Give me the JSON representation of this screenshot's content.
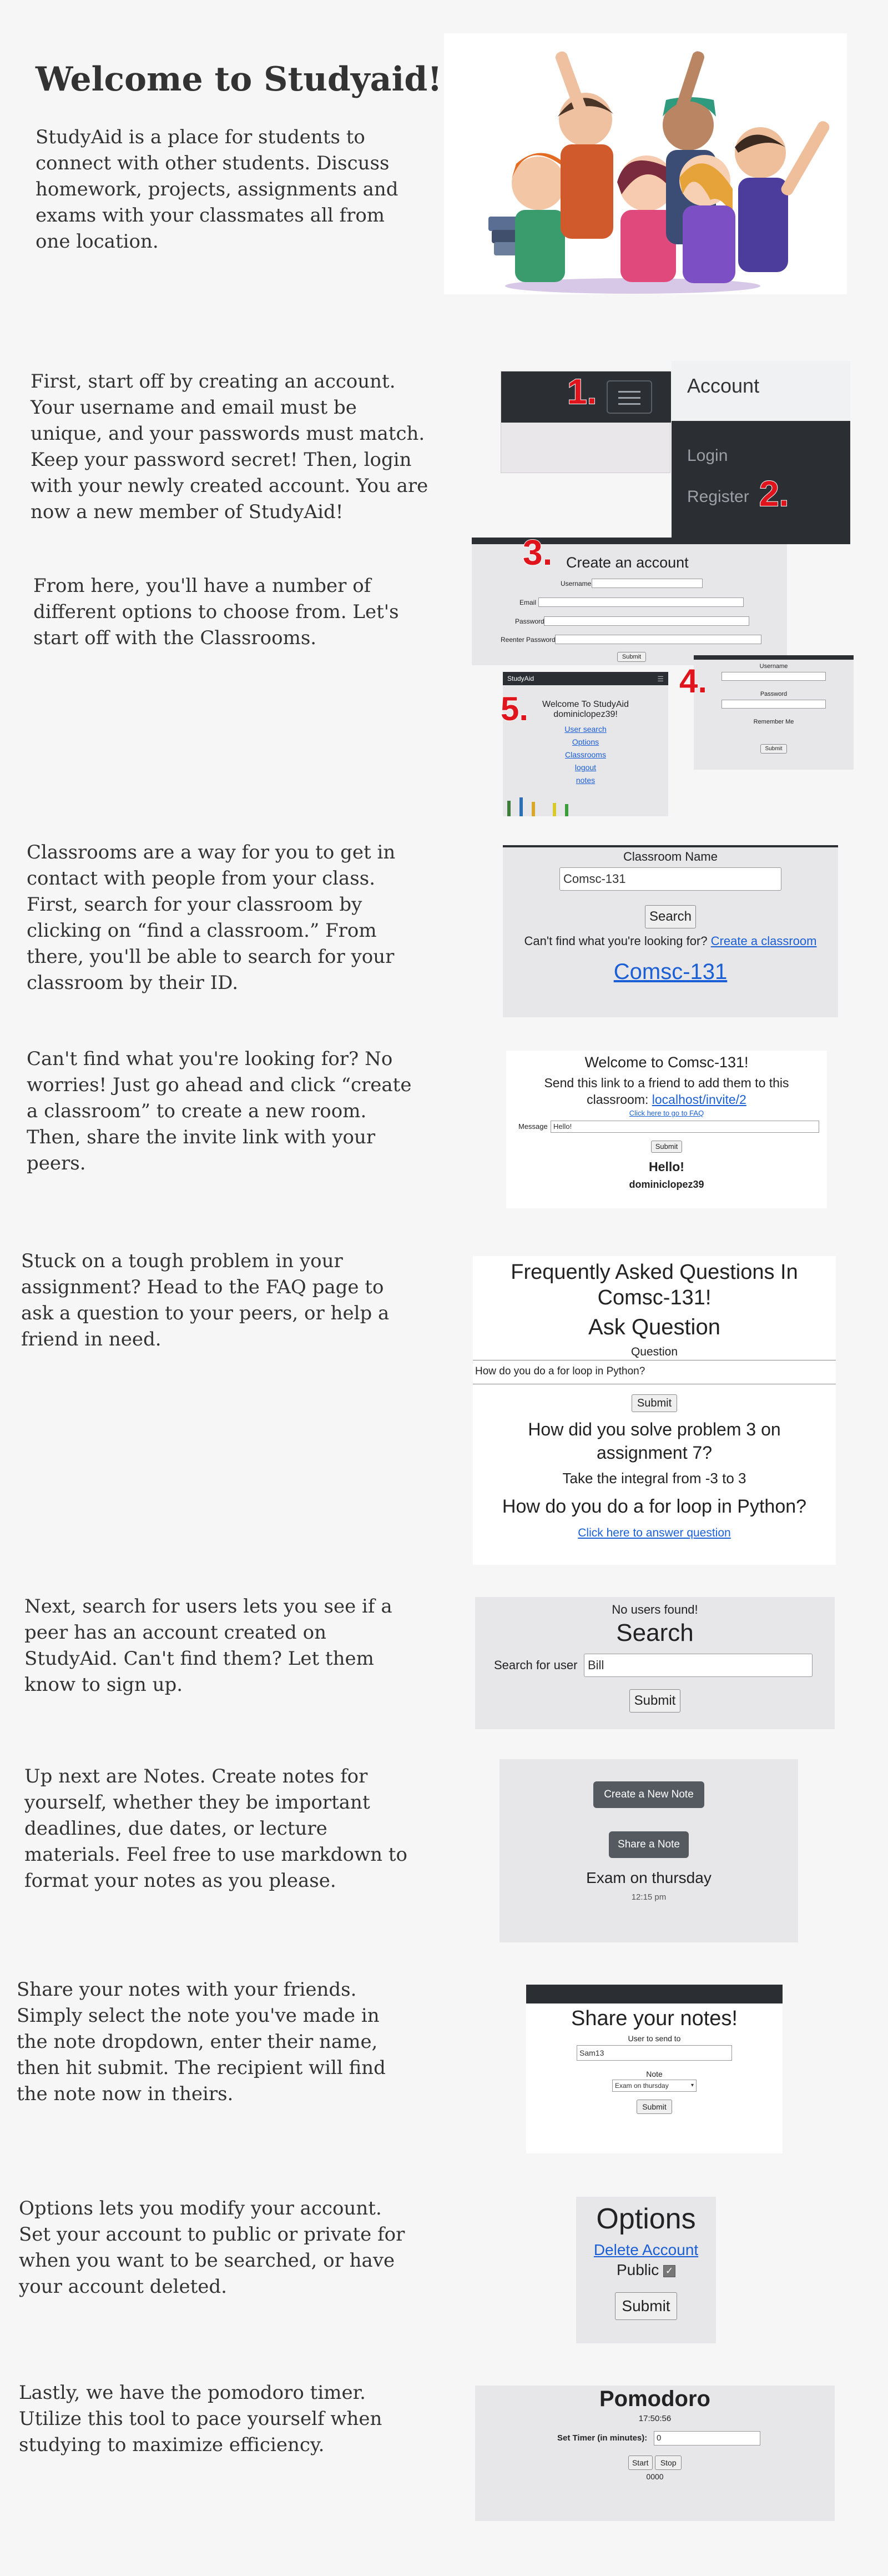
{
  "hero": {
    "title": "Welcome to Studyaid!",
    "text": "StudyAid is a place for students to connect with other students. Discuss homework, projects, assignments and exams with your classmates all from one location."
  },
  "sections": {
    "account": "First, start off by creating an account. Your username and email must be unique, and your passwords must match.\nKeep your password secret! Then, login with your newly created account. You are now a new member of StudyAid!",
    "options_intro": "From here, you'll have a number of different options to choose from. Let's start off with the Classrooms.",
    "classrooms": "Classrooms are a way for you to get in contact with people from your class. First, search for your classroom by clicking on “find a classroom.” From there, you'll be able to search for your classroom by their ID.",
    "create_classroom": "Can't find what you're looking for? No worries! Just go ahead and click “create a classroom” to create a new room. Then, share the invite link with your peers.",
    "faq": "Stuck on a tough problem in your assignment? Head to the FAQ page to ask a question to your peers, or help a friend in need.",
    "users": "Next, search for users lets you see if a peer has an account created on StudyAid. Can't find them? Let them know to sign up.",
    "notes": "Up next are Notes. Create notes for yourself, whether they be important deadlines, due dates, or lecture materials. Feel free to use markdown to format your notes as you please.",
    "share": "Share your notes with your friends. Simply select the note you've made in the note dropdown, enter their name, then hit submit. The recipient will find the note now in theirs.",
    "options": "Options lets you modify your account. Set your account to public or private for when you want to be searched, or have your account deleted.",
    "pomodoro": "Lastly, we have the pomodoro timer. Utilize this tool to pace yourself when studying to maximize efficiency."
  },
  "nav_shot": {
    "marker1": "1.",
    "marker2": "2.",
    "account_label": "Account",
    "login": "Login",
    "register": "Register"
  },
  "register_shot": {
    "marker": "3.",
    "title": "Create an account",
    "username": "Username",
    "email": "Email",
    "password": "Password",
    "reenter": "Reenter Password",
    "submit": "Submit"
  },
  "login_shot": {
    "marker": "4.",
    "username": "Username",
    "password": "Password",
    "remember": "Remember Me",
    "submit": "Submit"
  },
  "home_shot": {
    "marker": "5.",
    "brand": "StudyAid",
    "welcome": "Welcome To StudyAid",
    "user": "dominiclopez39!",
    "links": [
      "User search",
      "Options",
      "Classrooms",
      "logout",
      "notes"
    ]
  },
  "classroom_shot": {
    "label": "Classroom Name",
    "value": "Comsc-131",
    "search": "Search",
    "cant_find": "Can't find what you're looking for?",
    "create_link": "Create a classroom",
    "result": "Comsc-131"
  },
  "room_shot": {
    "title": "Welcome to Comsc-131!",
    "share_text": "Send this link to a friend to add them to this classroom:",
    "invite": "localhost/invite/2",
    "faq_link": "Click here to go to FAQ",
    "message_label": "Message",
    "message_value": "Hello!",
    "submit": "Submit",
    "msg": "Hello!",
    "author": "dominiclopez39"
  },
  "faq_shot": {
    "title": "Frequently Asked Questions In Comsc-131!",
    "ask": "Ask Question",
    "q_label": "Question",
    "q_value": "How do you do a for loop in Python?",
    "submit": "Submit",
    "q1": "How did you solve problem 3 on assignment 7?",
    "a1": "Take the integral from -3 to 3",
    "q2": "How do you do a for loop in Python?",
    "answer_link": "Click here to answer question"
  },
  "users_shot": {
    "none": "No users found!",
    "title": "Search",
    "label": "Search for user",
    "value": "Bill",
    "submit": "Submit"
  },
  "notes_shot": {
    "create": "Create a New Note",
    "share": "Share a Note",
    "note_title": "Exam on thursday",
    "time": "12:15 pm"
  },
  "share_shot": {
    "title": "Share your notes!",
    "user_label": "User to send to",
    "user_value": "Sam13",
    "note_label": "Note",
    "note_value": "Exam on thursday",
    "submit": "Submit"
  },
  "options_shot": {
    "title": "Options",
    "delete": "Delete Account",
    "public": "Public",
    "submit": "Submit"
  },
  "pomo_shot": {
    "title": "Pomodoro",
    "clock": "17:50:56",
    "label": "Set Timer (in minutes):",
    "value": "0",
    "start": "Start",
    "stop": "Stop",
    "count": "0000"
  },
  "colors": {
    "background": "#f7f6f7",
    "panel": "#e7e6e8",
    "navbar": "#2b2f33",
    "marker": "#e0141c",
    "link": "#1a5fd6"
  }
}
